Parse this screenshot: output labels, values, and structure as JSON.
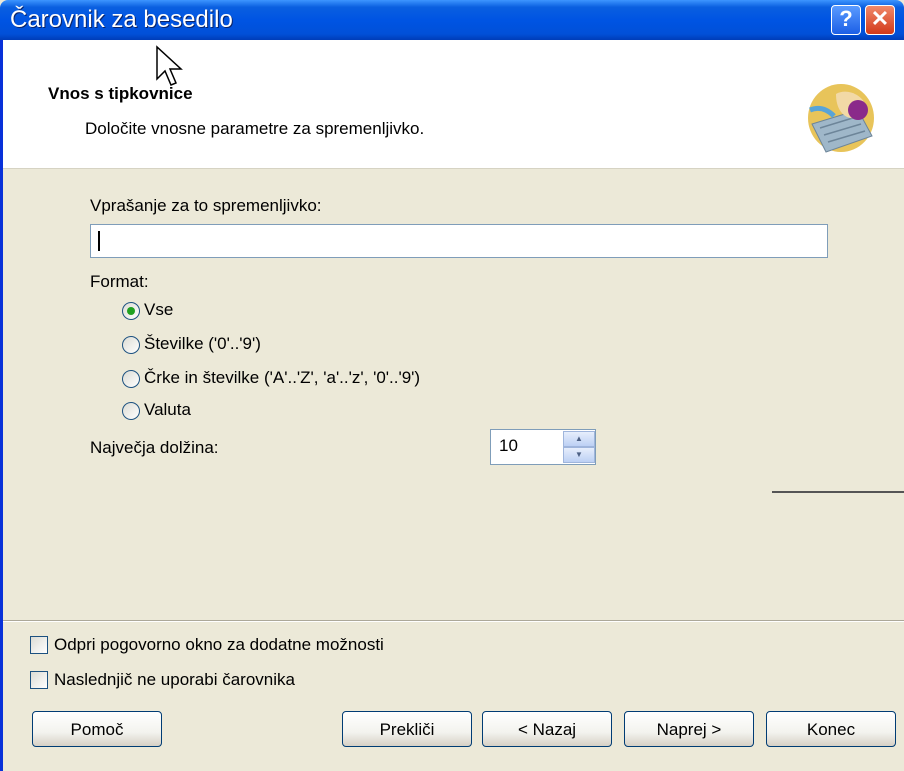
{
  "window": {
    "title": "Čarovnik za besedilo"
  },
  "titlebar": {
    "help_label": "?",
    "close_label": "✕"
  },
  "header": {
    "title": "Vnos s tipkovnice",
    "subtitle": "Določite vnosne parametre za spremenljivko."
  },
  "form": {
    "question_label": "Vprašanje za to spremenljivko:",
    "question_value": "",
    "format_label": "Format:",
    "format_options": [
      {
        "label": "Vse",
        "checked": true
      },
      {
        "label": "Številke ('0'..'9')",
        "checked": false
      },
      {
        "label": "Črke in številke ('A'..'Z', 'a'..'z', '0'..'9')",
        "checked": false
      },
      {
        "label": "Valuta",
        "checked": false
      }
    ],
    "max_length_label": "Največja dolžina:",
    "max_length_value": "10"
  },
  "options": {
    "open_dialog_label": "Odpri pogovorno okno za dodatne možnosti",
    "dont_use_wizard_label": "Naslednjič ne uporabi čarovnika"
  },
  "buttons": {
    "help": "Pomoč",
    "cancel": "Prekliči",
    "back": "< Nazaj",
    "next": "Naprej >",
    "finish": "Konec"
  },
  "colors": {
    "titlebar": "#0054e3",
    "dialog_bg": "#ece9d8",
    "radio_dot": "#21a121"
  }
}
